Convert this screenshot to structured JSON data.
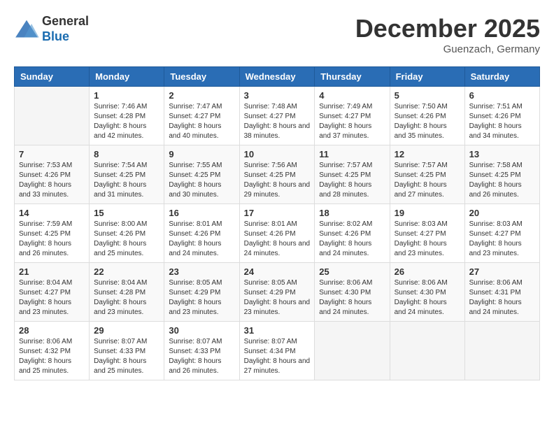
{
  "header": {
    "logo_general": "General",
    "logo_blue": "Blue",
    "month_title": "December 2025",
    "location": "Guenzach, Germany"
  },
  "days_of_week": [
    "Sunday",
    "Monday",
    "Tuesday",
    "Wednesday",
    "Thursday",
    "Friday",
    "Saturday"
  ],
  "weeks": [
    [
      {
        "day": "",
        "sunrise": "",
        "sunset": "",
        "daylight": ""
      },
      {
        "day": "1",
        "sunrise": "Sunrise: 7:46 AM",
        "sunset": "Sunset: 4:28 PM",
        "daylight": "Daylight: 8 hours and 42 minutes."
      },
      {
        "day": "2",
        "sunrise": "Sunrise: 7:47 AM",
        "sunset": "Sunset: 4:27 PM",
        "daylight": "Daylight: 8 hours and 40 minutes."
      },
      {
        "day": "3",
        "sunrise": "Sunrise: 7:48 AM",
        "sunset": "Sunset: 4:27 PM",
        "daylight": "Daylight: 8 hours and 38 minutes."
      },
      {
        "day": "4",
        "sunrise": "Sunrise: 7:49 AM",
        "sunset": "Sunset: 4:27 PM",
        "daylight": "Daylight: 8 hours and 37 minutes."
      },
      {
        "day": "5",
        "sunrise": "Sunrise: 7:50 AM",
        "sunset": "Sunset: 4:26 PM",
        "daylight": "Daylight: 8 hours and 35 minutes."
      },
      {
        "day": "6",
        "sunrise": "Sunrise: 7:51 AM",
        "sunset": "Sunset: 4:26 PM",
        "daylight": "Daylight: 8 hours and 34 minutes."
      }
    ],
    [
      {
        "day": "7",
        "sunrise": "Sunrise: 7:53 AM",
        "sunset": "Sunset: 4:26 PM",
        "daylight": "Daylight: 8 hours and 33 minutes."
      },
      {
        "day": "8",
        "sunrise": "Sunrise: 7:54 AM",
        "sunset": "Sunset: 4:25 PM",
        "daylight": "Daylight: 8 hours and 31 minutes."
      },
      {
        "day": "9",
        "sunrise": "Sunrise: 7:55 AM",
        "sunset": "Sunset: 4:25 PM",
        "daylight": "Daylight: 8 hours and 30 minutes."
      },
      {
        "day": "10",
        "sunrise": "Sunrise: 7:56 AM",
        "sunset": "Sunset: 4:25 PM",
        "daylight": "Daylight: 8 hours and 29 minutes."
      },
      {
        "day": "11",
        "sunrise": "Sunrise: 7:57 AM",
        "sunset": "Sunset: 4:25 PM",
        "daylight": "Daylight: 8 hours and 28 minutes."
      },
      {
        "day": "12",
        "sunrise": "Sunrise: 7:57 AM",
        "sunset": "Sunset: 4:25 PM",
        "daylight": "Daylight: 8 hours and 27 minutes."
      },
      {
        "day": "13",
        "sunrise": "Sunrise: 7:58 AM",
        "sunset": "Sunset: 4:25 PM",
        "daylight": "Daylight: 8 hours and 26 minutes."
      }
    ],
    [
      {
        "day": "14",
        "sunrise": "Sunrise: 7:59 AM",
        "sunset": "Sunset: 4:25 PM",
        "daylight": "Daylight: 8 hours and 26 minutes."
      },
      {
        "day": "15",
        "sunrise": "Sunrise: 8:00 AM",
        "sunset": "Sunset: 4:26 PM",
        "daylight": "Daylight: 8 hours and 25 minutes."
      },
      {
        "day": "16",
        "sunrise": "Sunrise: 8:01 AM",
        "sunset": "Sunset: 4:26 PM",
        "daylight": "Daylight: 8 hours and 24 minutes."
      },
      {
        "day": "17",
        "sunrise": "Sunrise: 8:01 AM",
        "sunset": "Sunset: 4:26 PM",
        "daylight": "Daylight: 8 hours and 24 minutes."
      },
      {
        "day": "18",
        "sunrise": "Sunrise: 8:02 AM",
        "sunset": "Sunset: 4:26 PM",
        "daylight": "Daylight: 8 hours and 24 minutes."
      },
      {
        "day": "19",
        "sunrise": "Sunrise: 8:03 AM",
        "sunset": "Sunset: 4:27 PM",
        "daylight": "Daylight: 8 hours and 23 minutes."
      },
      {
        "day": "20",
        "sunrise": "Sunrise: 8:03 AM",
        "sunset": "Sunset: 4:27 PM",
        "daylight": "Daylight: 8 hours and 23 minutes."
      }
    ],
    [
      {
        "day": "21",
        "sunrise": "Sunrise: 8:04 AM",
        "sunset": "Sunset: 4:27 PM",
        "daylight": "Daylight: 8 hours and 23 minutes."
      },
      {
        "day": "22",
        "sunrise": "Sunrise: 8:04 AM",
        "sunset": "Sunset: 4:28 PM",
        "daylight": "Daylight: 8 hours and 23 minutes."
      },
      {
        "day": "23",
        "sunrise": "Sunrise: 8:05 AM",
        "sunset": "Sunset: 4:29 PM",
        "daylight": "Daylight: 8 hours and 23 minutes."
      },
      {
        "day": "24",
        "sunrise": "Sunrise: 8:05 AM",
        "sunset": "Sunset: 4:29 PM",
        "daylight": "Daylight: 8 hours and 23 minutes."
      },
      {
        "day": "25",
        "sunrise": "Sunrise: 8:06 AM",
        "sunset": "Sunset: 4:30 PM",
        "daylight": "Daylight: 8 hours and 24 minutes."
      },
      {
        "day": "26",
        "sunrise": "Sunrise: 8:06 AM",
        "sunset": "Sunset: 4:30 PM",
        "daylight": "Daylight: 8 hours and 24 minutes."
      },
      {
        "day": "27",
        "sunrise": "Sunrise: 8:06 AM",
        "sunset": "Sunset: 4:31 PM",
        "daylight": "Daylight: 8 hours and 24 minutes."
      }
    ],
    [
      {
        "day": "28",
        "sunrise": "Sunrise: 8:06 AM",
        "sunset": "Sunset: 4:32 PM",
        "daylight": "Daylight: 8 hours and 25 minutes."
      },
      {
        "day": "29",
        "sunrise": "Sunrise: 8:07 AM",
        "sunset": "Sunset: 4:33 PM",
        "daylight": "Daylight: 8 hours and 25 minutes."
      },
      {
        "day": "30",
        "sunrise": "Sunrise: 8:07 AM",
        "sunset": "Sunset: 4:33 PM",
        "daylight": "Daylight: 8 hours and 26 minutes."
      },
      {
        "day": "31",
        "sunrise": "Sunrise: 8:07 AM",
        "sunset": "Sunset: 4:34 PM",
        "daylight": "Daylight: 8 hours and 27 minutes."
      },
      {
        "day": "",
        "sunrise": "",
        "sunset": "",
        "daylight": ""
      },
      {
        "day": "",
        "sunrise": "",
        "sunset": "",
        "daylight": ""
      },
      {
        "day": "",
        "sunrise": "",
        "sunset": "",
        "daylight": ""
      }
    ]
  ]
}
